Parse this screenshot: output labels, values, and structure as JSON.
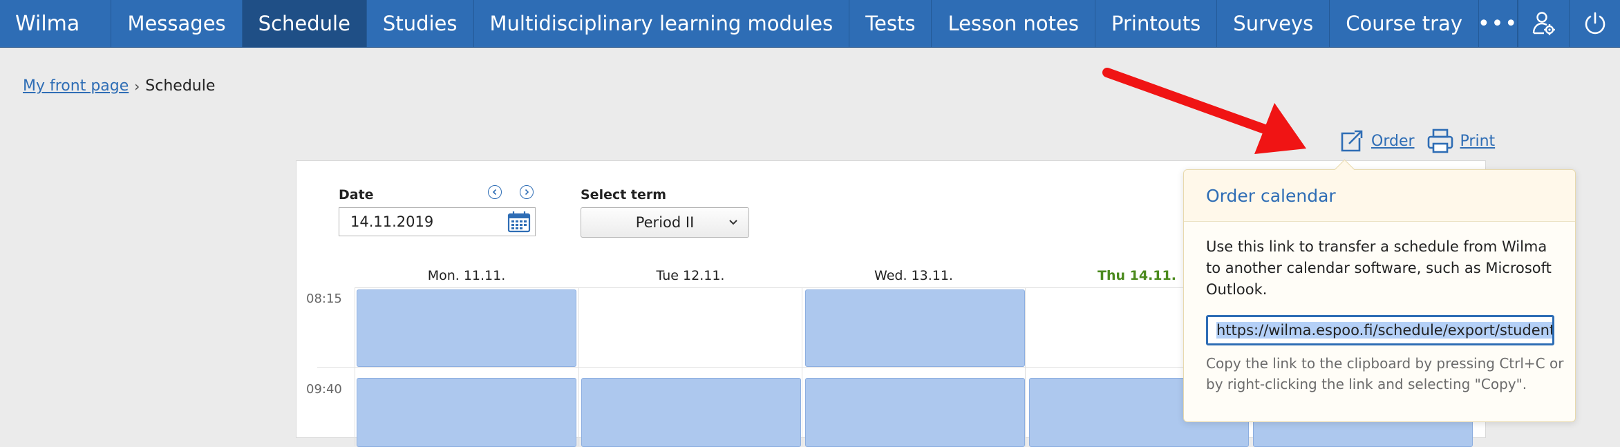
{
  "app": {
    "title": "Wilma"
  },
  "nav": {
    "items": [
      {
        "label": "Messages"
      },
      {
        "label": "Schedule",
        "active": true
      },
      {
        "label": "Studies"
      },
      {
        "label": "Multidisciplinary learning modules"
      },
      {
        "label": "Tests"
      },
      {
        "label": "Lesson notes"
      },
      {
        "label": "Printouts"
      },
      {
        "label": "Surveys"
      },
      {
        "label": "Course tray"
      }
    ],
    "more_label": "•••",
    "icons": [
      "user-settings-icon",
      "power-icon"
    ]
  },
  "breadcrumb": {
    "home": "My front page",
    "separator": "›",
    "current": "Schedule"
  },
  "actions": {
    "order": "Order",
    "print": "Print"
  },
  "form": {
    "date_label": "Date",
    "date_value": "14.11.2019",
    "term_label": "Select term",
    "term_value": "Period II"
  },
  "schedule": {
    "days": [
      {
        "label": "Mon. 11.11."
      },
      {
        "label": "Tue 12.11."
      },
      {
        "label": "Wed. 13.11."
      },
      {
        "label": "Thu 14.11.",
        "today": true
      }
    ],
    "times": [
      "08:15",
      "09:40"
    ]
  },
  "popover": {
    "title": "Order calendar",
    "body": "Use this link to transfer a schedule from Wilma to another calendar software, such as Microsoft Outlook.",
    "url": "https://wilma.espoo.fi/schedule/export/students/",
    "hint": "Copy the link to the clipboard by pressing Ctrl+C or by right-clicking the link and selecting \"Copy\"."
  },
  "colors": {
    "nav": "#2e6db5",
    "lesson": "#adc8ee",
    "today": "#4b8a1e",
    "arrow": "#f01414"
  }
}
